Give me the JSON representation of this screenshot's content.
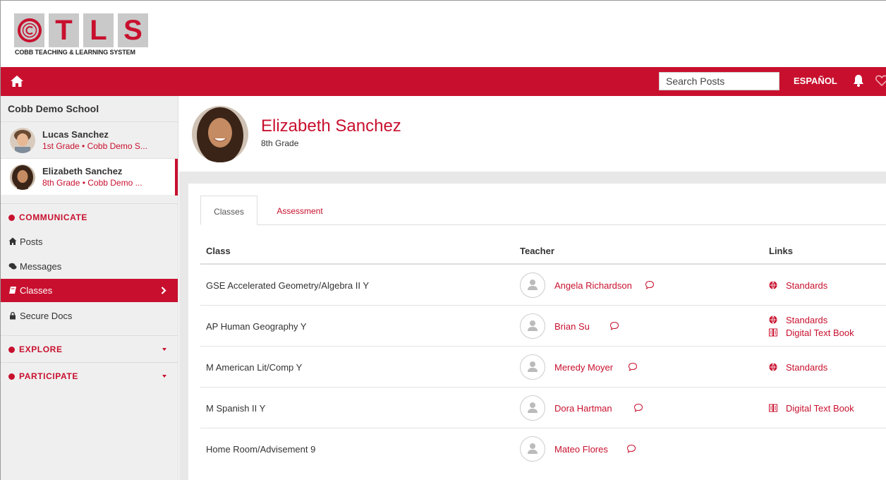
{
  "logo": {
    "letters": [
      "C",
      "T",
      "L",
      "S"
    ],
    "tagline": "COBB TEACHING & LEARNING SYSTEM"
  },
  "topbar": {
    "search_placeholder": "Search Posts",
    "language_label": "ESPAÑOL",
    "brand_color": "#c8102e"
  },
  "sidebar": {
    "school": "Cobb Demo School",
    "students": [
      {
        "name": "Lucas Sanchez",
        "subtitle": "1st Grade • Cobb Demo S..."
      },
      {
        "name": "Elizabeth Sanchez",
        "subtitle": "8th Grade • Cobb Demo ..."
      }
    ],
    "communicate_label": "COMMUNICATE",
    "nav": [
      {
        "label": "Posts",
        "icon": "home-icon"
      },
      {
        "label": "Messages",
        "icon": "chat-icon"
      },
      {
        "label": "Classes",
        "icon": "book-icon"
      },
      {
        "label": "Secure Docs",
        "icon": "lock-icon"
      }
    ],
    "explore_label": "EXPLORE",
    "participate_label": "PARTICIPATE"
  },
  "profile": {
    "name": "Elizabeth Sanchez",
    "grade": "8th Grade"
  },
  "tabs": {
    "classes": "Classes",
    "assessment": "Assessment"
  },
  "table": {
    "headers": {
      "class": "Class",
      "teacher": "Teacher",
      "links": "Links"
    },
    "rows": [
      {
        "class": "GSE Accelerated Geometry/Algebra II Y",
        "teacher": "Angela Richardson",
        "links": [
          "Standards"
        ]
      },
      {
        "class": "AP Human Geography Y",
        "teacher": "Brian Su",
        "links": [
          "Standards",
          "Digital Text Book"
        ]
      },
      {
        "class": "M American Lit/Comp Y",
        "teacher": "Meredy Moyer",
        "links": [
          "Standards"
        ]
      },
      {
        "class": "M Spanish II Y",
        "teacher": "Dora Hartman",
        "links": [
          "Digital Text Book"
        ]
      },
      {
        "class": "Home Room/Advisement 9",
        "teacher": "Mateo Flores",
        "links": []
      }
    ]
  }
}
